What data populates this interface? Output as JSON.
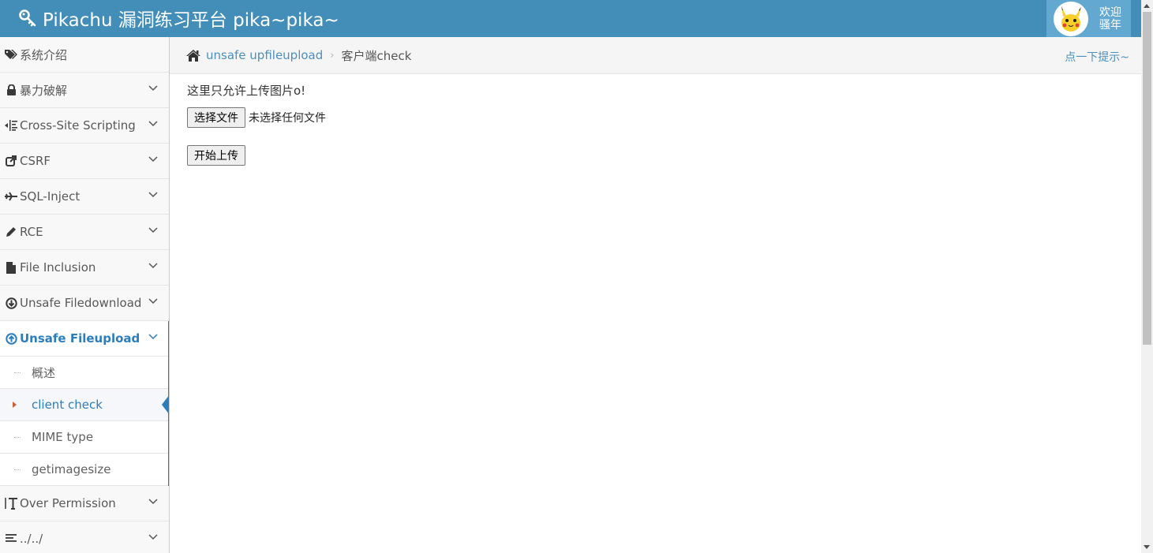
{
  "header": {
    "brand": "Pikachu 漏洞练习平台 pika~pika~",
    "welcome_line1": "欢迎",
    "welcome_line2": "骚年"
  },
  "sidebar": {
    "items": [
      {
        "label": "系统介绍",
        "icon": "tags-icon"
      },
      {
        "label": "暴力破解",
        "icon": "lock-icon"
      },
      {
        "label": "Cross-Site Scripting",
        "icon": "indent-icon"
      },
      {
        "label": "CSRF",
        "icon": "share-icon"
      },
      {
        "label": "SQL-Inject",
        "icon": "plane-icon"
      },
      {
        "label": "RCE",
        "icon": "pencil-icon"
      },
      {
        "label": "File Inclusion",
        "icon": "file-icon"
      },
      {
        "label": "Unsafe Filedownload",
        "icon": "download-circle-icon"
      },
      {
        "label": "Unsafe Fileupload",
        "icon": "upload-circle-icon"
      },
      {
        "label": "Over Permission",
        "icon": "text-height-icon"
      },
      {
        "label": "../../",
        "icon": "align-left-icon"
      }
    ],
    "subitems": [
      {
        "label": "概述"
      },
      {
        "label": "client check"
      },
      {
        "label": "MIME type"
      },
      {
        "label": "getimagesize"
      }
    ]
  },
  "breadcrumb": {
    "link": "unsafe upfileupload",
    "separator": "›",
    "current": "客户端check",
    "hint": "点一下提示~"
  },
  "main": {
    "notice": "这里只允许上传图片o!",
    "choose_file_label": "选择文件",
    "file_status": "未选择任何文件",
    "upload_label": "开始上传"
  },
  "colors": {
    "navbar": "#438eb9",
    "accent": "#2b7dbc",
    "link": "#4c8fbd"
  }
}
